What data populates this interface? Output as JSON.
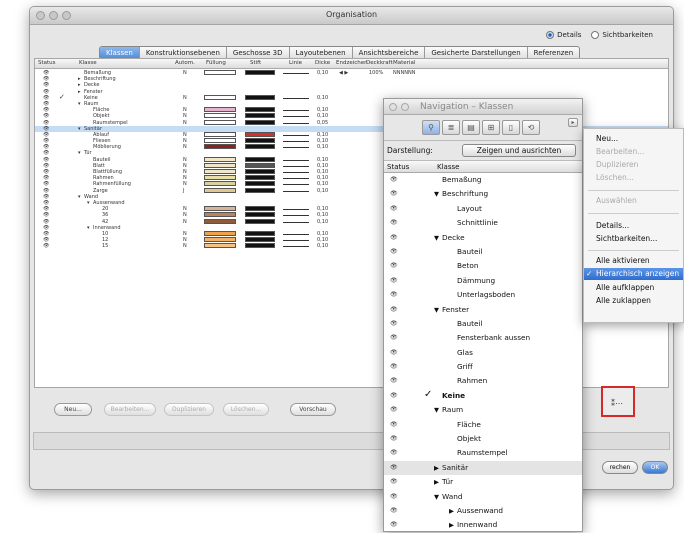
{
  "window": {
    "title": "Organisation"
  },
  "radios": {
    "details": "Details",
    "sichtbarkeiten": "Sichtbarkeiten"
  },
  "tabs": [
    "Klassen",
    "Konstruktionsebenen",
    "Geschosse 3D",
    "Layoutebenen",
    "Ansichtsbereiche",
    "Gesicherte Darstellungen",
    "Referenzen"
  ],
  "columns": [
    "Status",
    "Klasse",
    "Autom.",
    "Füllung",
    "Stift",
    "Linie",
    "Dicke",
    "Endzeichen",
    "Deckkraft",
    "Material"
  ],
  "classrows": [
    {
      "indent": 1,
      "arrow": "",
      "name": "Bemaßung",
      "auto": "N",
      "fill": "#ffffff",
      "pen": "#111111",
      "dicke": "0,10",
      "end": "◀ ▶",
      "deck": "100%",
      "mat": "NNNNNN",
      "check": ""
    },
    {
      "indent": 1,
      "arrow": "▸",
      "name": "Beschriftung",
      "auto": "",
      "fill": "",
      "pen": "",
      "dicke": "",
      "end": "",
      "deck": "",
      "mat": "",
      "check": ""
    },
    {
      "indent": 1,
      "arrow": "▸",
      "name": "Decke",
      "auto": "",
      "fill": "",
      "pen": "",
      "dicke": "",
      "end": "",
      "deck": "",
      "mat": "",
      "check": ""
    },
    {
      "indent": 1,
      "arrow": "▸",
      "name": "Fenster",
      "auto": "",
      "fill": "",
      "pen": "",
      "dicke": "",
      "end": "",
      "deck": "",
      "mat": "",
      "check": ""
    },
    {
      "indent": 1,
      "arrow": "",
      "name": "Keine",
      "auto": "N",
      "fill": "#ffffff",
      "pen": "#111111",
      "dicke": "0,10",
      "end": "",
      "deck": "",
      "mat": "",
      "check": "✓"
    },
    {
      "indent": 1,
      "arrow": "▾",
      "name": "Raum",
      "auto": "",
      "fill": "",
      "pen": "",
      "dicke": "",
      "end": "",
      "deck": "",
      "mat": "",
      "check": ""
    },
    {
      "indent": 2,
      "arrow": "",
      "name": "Fläche",
      "auto": "N",
      "fill": "#e6b3cf",
      "pen": "#111111",
      "dicke": "0,10",
      "end": "",
      "deck": "",
      "mat": "",
      "check": ""
    },
    {
      "indent": 2,
      "arrow": "",
      "name": "Objekt",
      "auto": "N",
      "fill": "#ffffff",
      "pen": "#111111",
      "dicke": "0,10",
      "end": "",
      "deck": "",
      "mat": "",
      "check": ""
    },
    {
      "indent": 2,
      "arrow": "",
      "name": "Raumstempel",
      "auto": "N",
      "fill": "#ffffff",
      "pen": "#111111",
      "dicke": "0,05",
      "end": "",
      "deck": "",
      "mat": "",
      "check": ""
    },
    {
      "indent": 1,
      "arrow": "▾",
      "name": "Sanitär",
      "auto": "",
      "fill": "",
      "pen": "",
      "dicke": "",
      "end": "",
      "deck": "",
      "mat": "",
      "check": "",
      "sel": true
    },
    {
      "indent": 2,
      "arrow": "",
      "name": "Ablauf",
      "auto": "N",
      "fill": "#ffffff",
      "pen": "#d6302a",
      "dicke": "0,10",
      "end": "",
      "deck": "",
      "mat": "",
      "check": ""
    },
    {
      "indent": 2,
      "arrow": "",
      "name": "Fliesen",
      "auto": "N",
      "fill": "#ffffff",
      "pen": "#111111",
      "dicke": "0,10",
      "end": "",
      "deck": "",
      "mat": "",
      "check": ""
    },
    {
      "indent": 2,
      "arrow": "",
      "name": "Möblierung",
      "auto": "N",
      "fill": "#8f2020",
      "pen": "#111111",
      "dicke": "0,10",
      "end": "",
      "deck": "",
      "mat": "",
      "check": ""
    },
    {
      "indent": 1,
      "arrow": "▾",
      "name": "Tür",
      "auto": "",
      "fill": "",
      "pen": "",
      "dicke": "",
      "end": "",
      "deck": "",
      "mat": "",
      "check": ""
    },
    {
      "indent": 2,
      "arrow": "",
      "name": "Bauteil",
      "auto": "N",
      "fill": "#f2e6c8",
      "pen": "#111111",
      "dicke": "0,10",
      "end": "",
      "deck": "",
      "mat": "",
      "check": ""
    },
    {
      "indent": 2,
      "arrow": "",
      "name": "Blatt",
      "auto": "N",
      "fill": "#f2e6c8",
      "pen": "#555555",
      "dicke": "0,10",
      "end": "",
      "deck": "",
      "mat": "",
      "check": ""
    },
    {
      "indent": 2,
      "arrow": "",
      "name": "Blattfüllung",
      "auto": "N",
      "fill": "#f2e6c8",
      "pen": "#111111",
      "dicke": "0,10",
      "end": "",
      "deck": "",
      "mat": "",
      "check": ""
    },
    {
      "indent": 2,
      "arrow": "",
      "name": "Rahmen",
      "auto": "N",
      "fill": "#e8dfa8",
      "pen": "#111111",
      "dicke": "0,10",
      "end": "",
      "deck": "",
      "mat": "",
      "check": ""
    },
    {
      "indent": 2,
      "arrow": "",
      "name": "Rahmenfüllung",
      "auto": "N",
      "fill": "#d8d0a0",
      "pen": "#111111",
      "dicke": "0,10",
      "end": "",
      "deck": "",
      "mat": "",
      "check": ""
    },
    {
      "indent": 2,
      "arrow": "",
      "name": "Zarge",
      "auto": "J",
      "fill": "#e0c890",
      "pen": "#111111",
      "dicke": "0,10",
      "end": "",
      "deck": "",
      "mat": "",
      "check": ""
    },
    {
      "indent": 1,
      "arrow": "▾",
      "name": "Wand",
      "auto": "",
      "fill": "",
      "pen": "",
      "dicke": "",
      "end": "",
      "deck": "",
      "mat": "",
      "check": ""
    },
    {
      "indent": 2,
      "arrow": "▾",
      "name": "Aussenwand",
      "auto": "",
      "fill": "",
      "pen": "",
      "dicke": "",
      "end": "",
      "deck": "",
      "mat": "",
      "check": ""
    },
    {
      "indent": 3,
      "arrow": "",
      "name": "20",
      "auto": "N",
      "fill": "#d9b49a",
      "pen": "#111111",
      "dicke": "0,10",
      "end": "",
      "deck": "",
      "mat": "",
      "check": ""
    },
    {
      "indent": 3,
      "arrow": "",
      "name": "36",
      "auto": "N",
      "fill": "#b8835e",
      "pen": "#111111",
      "dicke": "0,10",
      "end": "",
      "deck": "",
      "mat": "",
      "check": ""
    },
    {
      "indent": 3,
      "arrow": "",
      "name": "42",
      "auto": "N",
      "fill": "#8e5c3a",
      "pen": "#111111",
      "dicke": "0,10",
      "end": "",
      "deck": "",
      "mat": "",
      "check": ""
    },
    {
      "indent": 2,
      "arrow": "▾",
      "name": "Innenwand",
      "auto": "",
      "fill": "",
      "pen": "",
      "dicke": "",
      "end": "",
      "deck": "",
      "mat": "",
      "check": ""
    },
    {
      "indent": 3,
      "arrow": "",
      "name": "10",
      "auto": "N",
      "fill": "#f0a24a",
      "pen": "#111111",
      "dicke": "0,10",
      "end": "",
      "deck": "",
      "mat": "",
      "check": ""
    },
    {
      "indent": 3,
      "arrow": "",
      "name": "12",
      "auto": "N",
      "fill": "#f3b167",
      "pen": "#111111",
      "dicke": "0,10",
      "end": "",
      "deck": "",
      "mat": "",
      "check": ""
    },
    {
      "indent": 3,
      "arrow": "",
      "name": "15",
      "auto": "N",
      "fill": "#f5c284",
      "pen": "#111111",
      "dicke": "0,10",
      "end": "",
      "deck": "",
      "mat": "",
      "check": ""
    }
  ],
  "buttons": {
    "neu": "Neu...",
    "bearbeiten": "Bearbeiten...",
    "duplizieren": "Duplizieren",
    "loeschen": "Löschen...",
    "vorschau": "Vorschau",
    "abbrechen": "rechen",
    "ok": "OK"
  },
  "nav": {
    "title": "Navigation – Klassen",
    "darstellung_label": "Darstellung:",
    "darstellung_value": "Zeigen und ausrichten",
    "col_status": "Status",
    "col_klasse": "Klasse",
    "items": [
      {
        "indent": 0,
        "arrow": "",
        "name": "Bemaßung",
        "bold": false,
        "check": ""
      },
      {
        "indent": 0,
        "arrow": "▼",
        "name": "Beschriftung",
        "bold": false,
        "check": ""
      },
      {
        "indent": 1,
        "arrow": "",
        "name": "Layout",
        "bold": false,
        "check": ""
      },
      {
        "indent": 1,
        "arrow": "",
        "name": "Schnittlinie",
        "bold": false,
        "check": ""
      },
      {
        "indent": 0,
        "arrow": "▼",
        "name": "Decke",
        "bold": false,
        "check": ""
      },
      {
        "indent": 1,
        "arrow": "",
        "name": "Bauteil",
        "bold": false,
        "check": ""
      },
      {
        "indent": 1,
        "arrow": "",
        "name": "Beton",
        "bold": false,
        "check": ""
      },
      {
        "indent": 1,
        "arrow": "",
        "name": "Dämmung",
        "bold": false,
        "check": ""
      },
      {
        "indent": 1,
        "arrow": "",
        "name": "Unterlagsboden",
        "bold": false,
        "check": ""
      },
      {
        "indent": 0,
        "arrow": "▼",
        "name": "Fenster",
        "bold": false,
        "check": ""
      },
      {
        "indent": 1,
        "arrow": "",
        "name": "Bauteil",
        "bold": false,
        "check": ""
      },
      {
        "indent": 1,
        "arrow": "",
        "name": "Fensterbank aussen",
        "bold": false,
        "check": ""
      },
      {
        "indent": 1,
        "arrow": "",
        "name": "Glas",
        "bold": false,
        "check": ""
      },
      {
        "indent": 1,
        "arrow": "",
        "name": "Griff",
        "bold": false,
        "check": ""
      },
      {
        "indent": 1,
        "arrow": "",
        "name": "Rahmen",
        "bold": false,
        "check": ""
      },
      {
        "indent": 0,
        "arrow": "",
        "name": "Keine",
        "bold": true,
        "check": "✓"
      },
      {
        "indent": 0,
        "arrow": "▼",
        "name": "Raum",
        "bold": false,
        "check": ""
      },
      {
        "indent": 1,
        "arrow": "",
        "name": "Fläche",
        "bold": false,
        "check": ""
      },
      {
        "indent": 1,
        "arrow": "",
        "name": "Objekt",
        "bold": false,
        "check": ""
      },
      {
        "indent": 1,
        "arrow": "",
        "name": "Raumstempel",
        "bold": false,
        "check": ""
      },
      {
        "indent": 0,
        "arrow": "▶",
        "name": "Sanitär",
        "bold": false,
        "check": "",
        "grey": true
      },
      {
        "indent": 0,
        "arrow": "▶",
        "name": "Tür",
        "bold": false,
        "check": ""
      },
      {
        "indent": 0,
        "arrow": "▼",
        "name": "Wand",
        "bold": false,
        "check": ""
      },
      {
        "indent": 1,
        "arrow": "▶",
        "name": "Aussenwand",
        "bold": false,
        "check": ""
      },
      {
        "indent": 1,
        "arrow": "▶",
        "name": "Innenwand",
        "bold": false,
        "check": ""
      }
    ]
  },
  "context_menu": {
    "items": [
      "Neu...",
      "Bearbeiten...",
      "Duplizieren",
      "Löschen...",
      "Auswählen",
      "Details...",
      "Sichtbarkeiten...",
      "Alle aktivieren",
      "Hierarchisch anzeigen",
      "Alle aufklappen",
      "Alle zuklappen"
    ],
    "checked": "✓"
  },
  "accent": "#3a79d1",
  "highlight_box_color": "#d52a2a"
}
